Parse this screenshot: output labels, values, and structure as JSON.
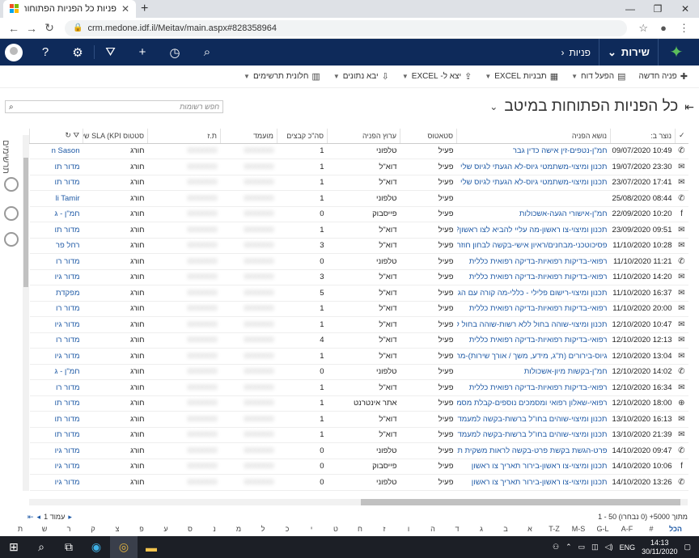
{
  "browser": {
    "tab_title": "פניות כל הפניות הפתוחות במיטב",
    "url": "crm.medone.idf.il/Meitav/main.aspx#828358964"
  },
  "crm": {
    "nav_service": "שירות",
    "nav_requests": "פניות"
  },
  "commands": [
    {
      "label": "פניה חדשה",
      "icon": "plus"
    },
    {
      "label": "הפעל דוח",
      "icon": "report"
    },
    {
      "label": "תבניות EXCEL",
      "icon": "excel"
    },
    {
      "label": "יצא ל- EXCEL",
      "icon": "export"
    },
    {
      "label": "יבא נתונים",
      "icon": "import"
    },
    {
      "label": "חלונית תרשימים",
      "icon": "chart"
    }
  ],
  "view_title": "כל הפניות הפתוחות במיטב",
  "search_placeholder": "חפש רשומות",
  "side_label": "תרשימים",
  "columns": [
    "נוצר ב:",
    "נושא הפניה",
    "סטאטוס",
    "ערוץ הפניה",
    "סה\"כ קבצים",
    "מועמד",
    "ת.ז",
    "סטטוס SLA (KPI של ...",
    "",
    ""
  ],
  "rows": [
    {
      "ch": "phone-icon",
      "created": "10:49 09/07/2020",
      "subject": "חמ\"ן-נטפים-זין אישה כדין גבר",
      "status": "פעיל",
      "channel": "טלפוני",
      "files": "1",
      "sla": "חורג",
      "owner": "n Sason"
    },
    {
      "ch": "mail-icon",
      "created": "23:30 19/07/2020",
      "subject": "תכנון ומיצוי-משתמטי גיוס-לא הגעתי לגיוס שלי",
      "status": "פעיל",
      "channel": "דוא\"ל",
      "files": "1",
      "sla": "חורג",
      "owner": "מדור תו"
    },
    {
      "ch": "mail-icon",
      "created": "17:41 23/07/2020",
      "subject": "תכנון ומיצוי-משתמטי גיוס-לא הגעתי לגיוס שלי",
      "status": "פעיל",
      "channel": "דוא\"ל",
      "files": "1",
      "sla": "חורג",
      "owner": "מדור תו"
    },
    {
      "ch": "phone-icon",
      "created": "08:44 25/08/2020",
      "subject": "",
      "status": "פעיל",
      "channel": "טלפוני",
      "files": "1",
      "sla": "חורג",
      "owner": "li Tamir"
    },
    {
      "ch": "facebook-icon",
      "created": "10:20 22/09/2020",
      "subject": "חמ\"ן-אישורי הגעה-אשכולות",
      "status": "פעיל",
      "channel": "פייסבוק",
      "files": "0",
      "sla": "חורג",
      "owner": "חמ\"ן - ג"
    },
    {
      "ch": "mail-icon",
      "created": "09:51 23/09/2020",
      "subject": "תכנון ומיצוי-צו ראשון-מה עליי להביא לצו ראשון?",
      "status": "פעיל",
      "channel": "דוא\"ל",
      "files": "1",
      "sla": "חורג",
      "owner": "מדור תו"
    },
    {
      "ch": "mail-icon",
      "created": "10:28 11/10/2020",
      "subject": "פסיכוטכני-מבחנים/ראיון אישי-בקשה לבחון חוזר",
      "status": "פעיל",
      "channel": "דוא\"ל",
      "files": "3",
      "sla": "חורג",
      "owner": "רחל פר"
    },
    {
      "ch": "phone-icon",
      "created": "11:21 11/10/2020",
      "subject": "רפואי-בדיקות רפואיות-בדיקה רפואית כללית",
      "status": "פעיל",
      "channel": "טלפוני",
      "files": "0",
      "sla": "חורג",
      "owner": "מדור רו"
    },
    {
      "ch": "mail-icon",
      "created": "14:20 11/10/2020",
      "subject": "רפואי-בדיקות רפואיות-בדיקה רפואית כללית",
      "status": "פעיל",
      "channel": "דוא\"ל",
      "files": "3",
      "sla": "חורג",
      "owner": "מדור גיו"
    },
    {
      "ch": "mail-icon",
      "created": "16:37 11/10/2020",
      "subject": "תכנון ומיצוי-רישום פלילי - כללי-מה קורה עם הגיוס שלי?",
      "status": "פעיל",
      "channel": "דוא\"ל",
      "files": "5",
      "sla": "חורג",
      "owner": "מפקדת"
    },
    {
      "ch": "mail-icon",
      "created": "20:00 11/10/2020",
      "subject": "רפואי-בדיקות רפואיות-בדיקה רפואית כללית",
      "status": "פעיל",
      "channel": "דוא\"ל",
      "files": "1",
      "sla": "חורג",
      "owner": "מדור רו"
    },
    {
      "ch": "mail-icon",
      "created": "10:47 12/10/2020",
      "subject": "תכנון ומיצוי-שוהה בחול ללא רשות-שוהה בחול ללא רשות",
      "status": "פעיל",
      "channel": "דוא\"ל",
      "files": "1",
      "sla": "חורג",
      "owner": "מדור גיו"
    },
    {
      "ch": "mail-icon",
      "created": "12:13 12/10/2020",
      "subject": "רפואי-בדיקות רפואיות-בדיקה רפואית כללית",
      "status": "פעיל",
      "channel": "דוא\"ל",
      "files": "4",
      "sla": "חורג",
      "owner": "מדור רו"
    },
    {
      "ch": "mail-icon",
      "created": "13:04 12/10/2020",
      "subject": "גיוס-בירורים (ת\"ג, מידע, משך / אורך שירות)-מה עליי לה...",
      "status": "פעיל",
      "channel": "דוא\"ל",
      "files": "1",
      "sla": "חורג",
      "owner": "מדור גיו"
    },
    {
      "ch": "phone-icon",
      "created": "14:02 12/10/2020",
      "subject": "חמ\"ן-בקשות מיון-אשכולות",
      "status": "פעיל",
      "channel": "טלפוני",
      "files": "0",
      "sla": "חורג",
      "owner": "חמ\"ן - ג"
    },
    {
      "ch": "mail-icon",
      "created": "16:34 12/10/2020",
      "subject": "רפואי-בדיקות רפואיות-בדיקה רפואית כללית",
      "status": "פעיל",
      "channel": "דוא\"ל",
      "files": "1",
      "sla": "חורג",
      "owner": "מדור רו"
    },
    {
      "ch": "globe-icon",
      "created": "18:00 12/10/2020",
      "subject": "רפואי-שאלון רפואי ומסמכים נוספים-קבלת מסמכים רפוא...",
      "status": "פעיל",
      "channel": "אתר אינטרנט",
      "files": "1",
      "sla": "חורג",
      "owner": "מדור תו"
    },
    {
      "ch": "mail-icon",
      "created": "16:13 13/10/2020",
      "subject": "תכנון ומיצוי-שוהים בחו\"ל ברשות-בקשה למעמד של בן מ...",
      "status": "פעיל",
      "channel": "דוא\"ל",
      "files": "1",
      "sla": "חורג",
      "owner": "מדור תו"
    },
    {
      "ch": "mail-icon",
      "created": "21:39 13/10/2020",
      "subject": "תכנון ומיצוי-שוהים בחו\"ל ברשות-בקשה למעמד של בן מ...",
      "status": "פעיל",
      "channel": "דוא\"ל",
      "files": "1",
      "sla": "חורג",
      "owner": "מדור תו"
    },
    {
      "ch": "phone-icon",
      "created": "09:47 14/10/2020",
      "subject": "פרט-הגשת בקשת פרט-בקשה לראות משקית ת\"ש",
      "status": "פעיל",
      "channel": "טלפוני",
      "files": "0",
      "sla": "חורג",
      "owner": "מדור גיו"
    },
    {
      "ch": "facebook-icon",
      "created": "10:06 14/10/2020",
      "subject": "תכנון ומיצוי-צו ראשון-בירור תאריך צו ראשון",
      "status": "פעיל",
      "channel": "פייסבוק",
      "files": "0",
      "sla": "חורג",
      "owner": "מדור גיו"
    },
    {
      "ch": "phone-icon",
      "created": "13:26 14/10/2020",
      "subject": "תכנון ומיצוי-צו ראשון-בירור תאריך צו ראשון",
      "status": "פעיל",
      "channel": "טלפוני",
      "files": "0",
      "sla": "חורג",
      "owner": "מדור גיו"
    }
  ],
  "pager": {
    "summary": "1 - 50 מתוך 5000+ (0 נבחרו)",
    "page_label": "עמוד 1"
  },
  "alphabet": [
    "הכל",
    "#",
    "A-F",
    "G-L",
    "M-S",
    "T-Z",
    "א",
    "ב",
    "ג",
    "ד",
    "ה",
    "ו",
    "ז",
    "ח",
    "ט",
    "י",
    "כ",
    "ל",
    "מ",
    "נ",
    "ס",
    "ע",
    "פ",
    "צ",
    "ק",
    "ר",
    "ש",
    "ת"
  ],
  "taskbar": {
    "lang": "ENG",
    "time": "14:13",
    "date": "30/11/2020"
  }
}
